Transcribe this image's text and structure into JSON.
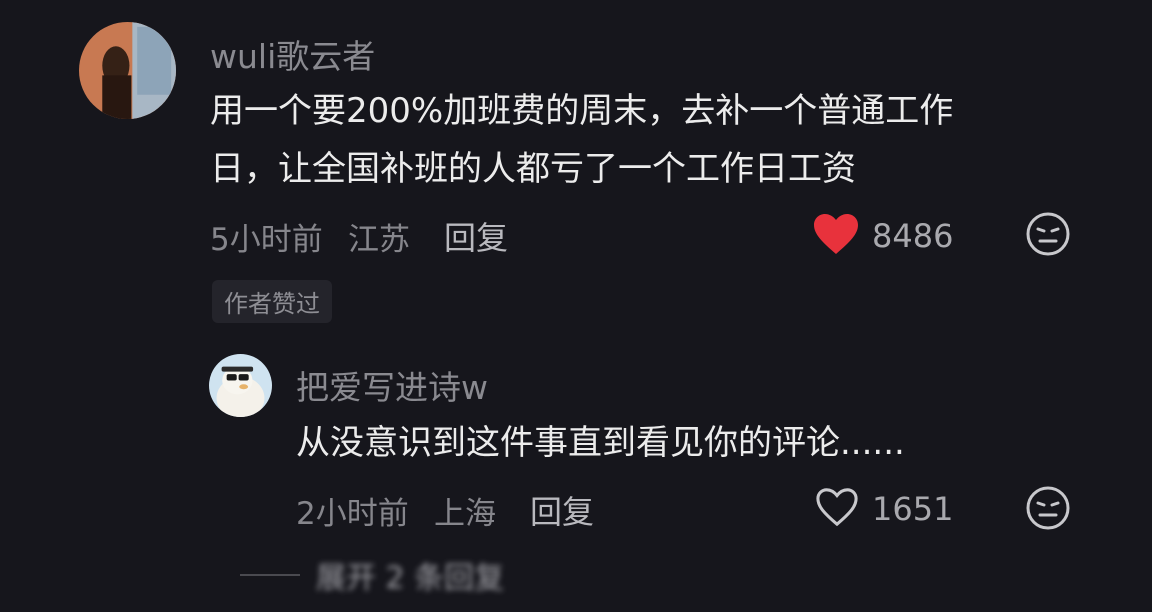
{
  "comments": [
    {
      "username": "wuli歌云者",
      "lines": [
        "用一个要200%加班费的周末，去补一个普通工作",
        "日，让全国补班的人都亏了一个工作日工资"
      ],
      "time": "5小时前",
      "location": "江苏",
      "reply_label": "回复",
      "likes": "8486",
      "liked": true,
      "author_liked_badge": "作者赞过"
    },
    {
      "username": "把爱写进诗w",
      "lines": [
        "从没意识到这件事直到看见你的评论......"
      ],
      "time": "2小时前",
      "location": "上海",
      "reply_label": "回复",
      "likes": "1651",
      "liked": false
    }
  ],
  "expand_replies": "展开 2 条回复",
  "colors": {
    "like_red": "#e8323c",
    "background": "#16161c"
  }
}
